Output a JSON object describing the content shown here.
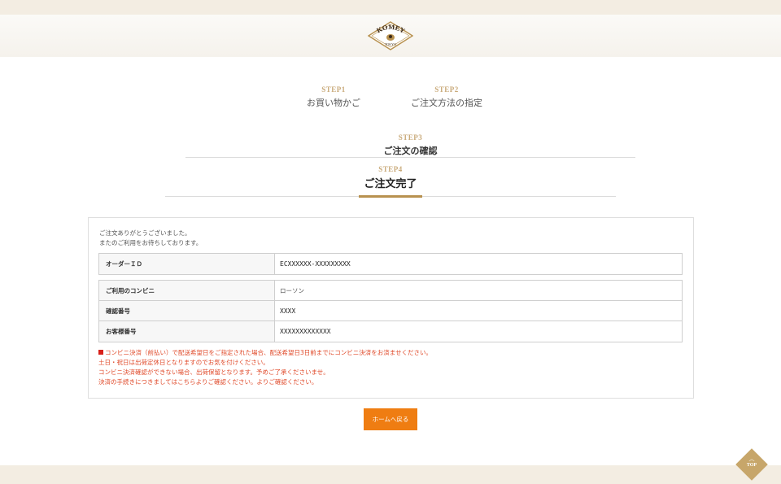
{
  "header": {
    "logo": {
      "text": "AKOMEYA",
      "sub": "TOKYO"
    }
  },
  "steps": [
    {
      "label": "STEP1",
      "title": "お買い物かご"
    },
    {
      "label": "STEP2",
      "title": "ご注文方法の指定"
    },
    {
      "label": "STEP3",
      "title": "ご注文の確認"
    },
    {
      "label": "STEP4",
      "title": "ご注文完了"
    }
  ],
  "complete": {
    "thanks_line1": "ご注文ありがとうございました。",
    "thanks_line2": "またのご利用をお待ちしております。",
    "order_id_label": "オーダーＩＤ",
    "order_id_value": "ECXXXXXX-XXXXXXXXX",
    "rows": [
      {
        "label": "ご利用のコンビニ",
        "value": "ローソン"
      },
      {
        "label": "確認番号",
        "value": "XXXX"
      },
      {
        "label": "お客様番号",
        "value": "XXXXXXXXXXXXX"
      }
    ],
    "notes": [
      "コンビニ決済（前払い）で配送希望日をご指定された場合、配送希望日3日前までにコンビニ決済をお済ませください。",
      "土日・祝日は出荷定休日となりますのでお気を付けください。",
      "コンビニ決済確認ができない場合、出荷保留となります。予めご了承くださいませ。",
      "決済の手続きにつきましてはこちらよりご確認ください。よりご確認ください。"
    ],
    "note_colors": {
      "text": "#e04a2a",
      "marker": "#d8201a"
    }
  },
  "actions": {
    "home_label": "ホームへ戻る",
    "home_color": "#ef7d12"
  },
  "page_top": {
    "label": "TOP",
    "arrow": "︿"
  },
  "colors": {
    "accent_gold": "#b8914f",
    "step_label": "#c9aa7a",
    "band": "#f3ede2"
  }
}
